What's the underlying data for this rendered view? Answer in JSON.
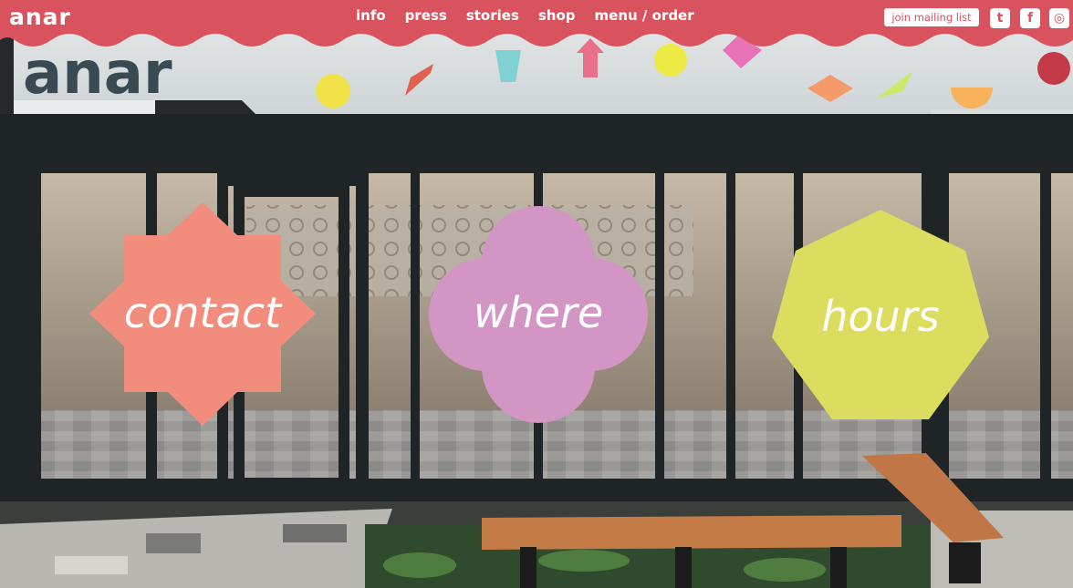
{
  "brand": {
    "name": "anar"
  },
  "nav": {
    "items": [
      "info",
      "press",
      "stories",
      "shop",
      "menu / order"
    ]
  },
  "header": {
    "mailing_label": "join mailing list",
    "social": [
      {
        "icon": "twitter-icon",
        "glyph": "t"
      },
      {
        "icon": "facebook-icon",
        "glyph": "f"
      },
      {
        "icon": "instagram-icon",
        "glyph": "◎"
      }
    ]
  },
  "awning": {
    "logo_text": "anar"
  },
  "buttons": {
    "contact": "contact",
    "where": "where",
    "hours": "hours"
  },
  "colors": {
    "header": "#d9535e",
    "contact": "#f28c7d",
    "where": "#d396c4",
    "hours": "#dcdc5f"
  }
}
